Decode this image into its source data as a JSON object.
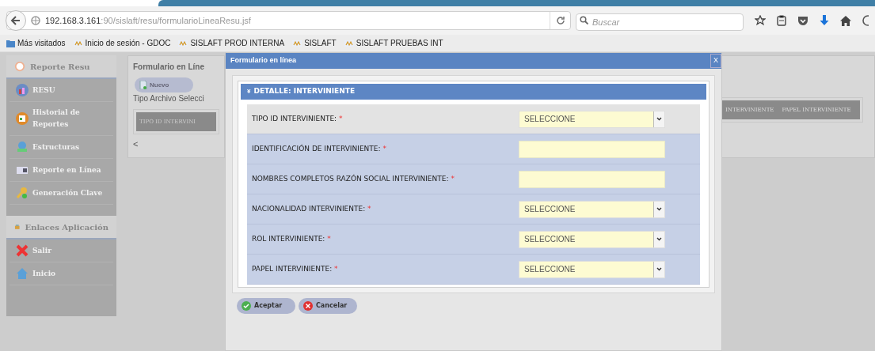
{
  "browser": {
    "url_host": "192.168.3.161",
    "url_rest": ":90/sislaft/resu/formularioLineaResu.jsf",
    "search": {
      "placeholder": "Buscar"
    },
    "bookmarks": [
      {
        "label": "Más visitados"
      },
      {
        "label": "Inicio de sesión - GDOC"
      },
      {
        "label": "SISLAFT PROD INTERNA"
      },
      {
        "label": "SISLAFT"
      },
      {
        "label": "SISLAFT PRUEBAS INT"
      }
    ]
  },
  "sidebar": {
    "sections": [
      {
        "title": "Reporte Resu",
        "items": [
          {
            "label": "RESU"
          },
          {
            "label": "Historial de Reportes"
          },
          {
            "label": "Estructuras"
          },
          {
            "label": "Reporte en Línea"
          },
          {
            "label": "Generación Clave"
          }
        ]
      },
      {
        "title": "Enlaces Aplicación",
        "items": [
          {
            "label": "Salir"
          },
          {
            "label": "Inicio"
          }
        ]
      }
    ]
  },
  "background_panel": {
    "title": "Formulario en Líne",
    "new_button": "Nuevo",
    "file_type_label": "Tipo Archivo Selecci",
    "columns_left": [
      "TIPO ID INTERVINI"
    ],
    "columns_right": [
      "INTERVINIENTE",
      "PAPEL INTERVINIENTE"
    ],
    "scroll_left": "<"
  },
  "dialog": {
    "title": "Formulario en línea",
    "close": "X",
    "section_title": "DETALLE: INTERVINIENTE",
    "section_toggle": "¥",
    "fields": [
      {
        "label": "TIPO ID INTERVINIENTE:",
        "required": "*",
        "kind": "select",
        "value": "SELECCIONE",
        "highlighted": true
      },
      {
        "label": "IDENTIFICACIÓN DE INTERVINIENTE:",
        "required": "*",
        "kind": "text",
        "highlighted": false
      },
      {
        "label": "NOMBRES COMPLETOS RAZÓN SOCIAL INTERVINIENTE:",
        "required": "*",
        "kind": "text",
        "highlighted": false
      },
      {
        "label": "NACIONALIDAD INTERVINIENTE:",
        "required": "*",
        "kind": "select",
        "value": "SELECCIONE",
        "highlighted": false
      },
      {
        "label": "ROL INTERVINIENTE:",
        "required": "*",
        "kind": "select",
        "value": "SELECCIONE",
        "highlighted": false
      },
      {
        "label": "PAPEL INTERVINIENTE:",
        "required": "*",
        "kind": "select",
        "value": "SELECCIONE",
        "highlighted": false
      }
    ],
    "buttons": [
      {
        "label": "Aceptar",
        "kind": "ok"
      },
      {
        "label": "Cancelar",
        "kind": "cancel"
      }
    ]
  }
}
